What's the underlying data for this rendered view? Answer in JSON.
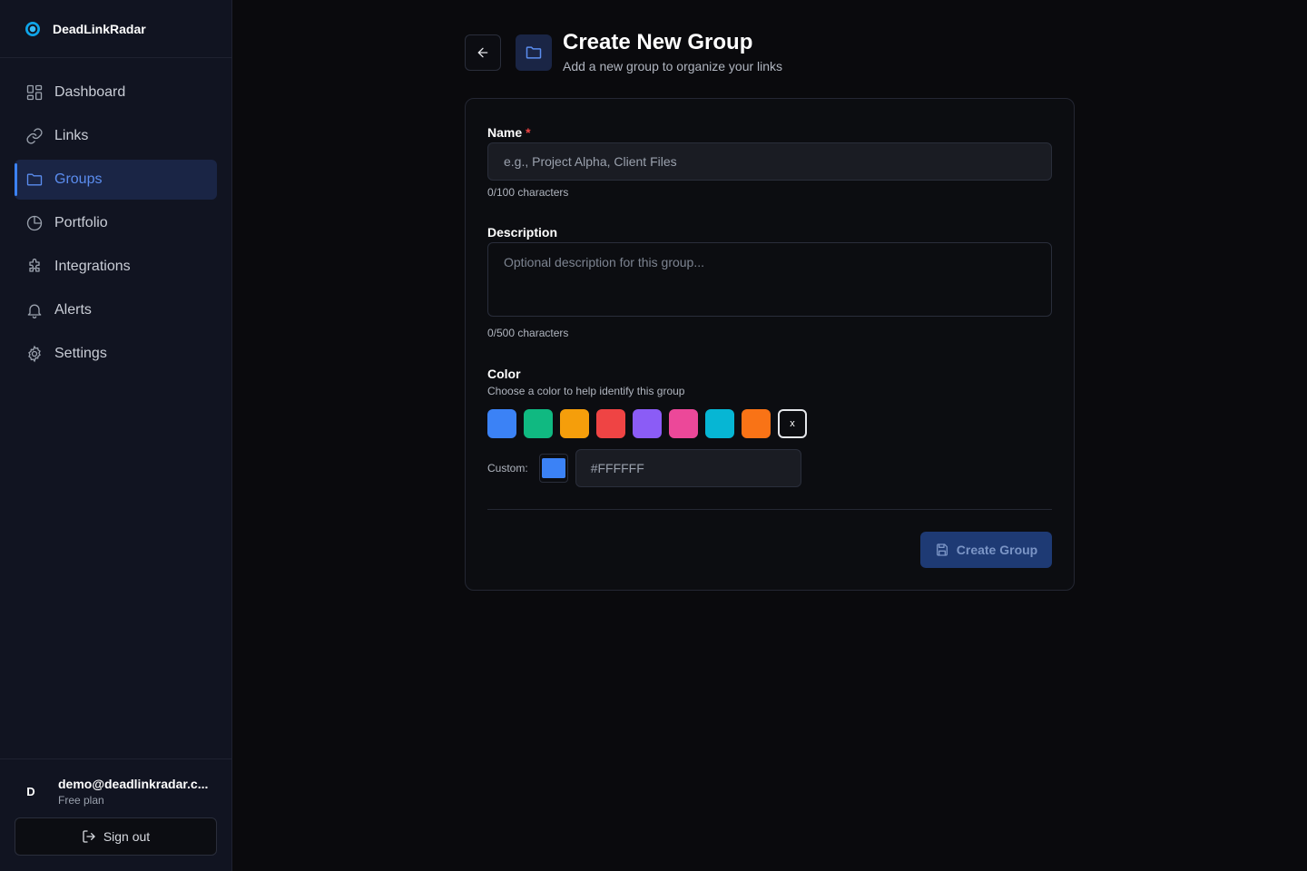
{
  "app": {
    "name": "DeadLinkRadar"
  },
  "sidebar": {
    "items": [
      {
        "label": "Dashboard",
        "icon": "dashboard-icon",
        "active": false
      },
      {
        "label": "Links",
        "icon": "link-icon",
        "active": false
      },
      {
        "label": "Groups",
        "icon": "folder-icon",
        "active": true
      },
      {
        "label": "Portfolio",
        "icon": "pie-chart-icon",
        "active": false
      },
      {
        "label": "Integrations",
        "icon": "puzzle-icon",
        "active": false
      },
      {
        "label": "Alerts",
        "icon": "bell-icon",
        "active": false
      },
      {
        "label": "Settings",
        "icon": "gear-icon",
        "active": false
      }
    ],
    "user": {
      "initial": "D",
      "email": "demo@deadlinkradar.c...",
      "plan": "Free plan"
    },
    "signout_label": "Sign out"
  },
  "header": {
    "title": "Create New Group",
    "subtitle": "Add a new group to organize your links"
  },
  "form": {
    "name": {
      "label": "Name",
      "required_mark": "*",
      "placeholder": "e.g., Project Alpha, Client Files",
      "counter": "0/100 characters"
    },
    "description": {
      "label": "Description",
      "placeholder": "Optional description for this group...",
      "counter": "0/500 characters"
    },
    "color": {
      "label": "Color",
      "hint": "Choose a color to help identify this group",
      "swatches": [
        "#3b82f6",
        "#10b981",
        "#f59e0b",
        "#ef4444",
        "#8b5cf6",
        "#ec4899",
        "#06b6d4",
        "#f97316"
      ],
      "clear_label": "x",
      "custom_label": "Custom:",
      "custom_preview": "#3b82f6",
      "custom_value": "#FFFFFF"
    },
    "submit_label": "Create Group"
  },
  "colors": {
    "accent": "#3b82f6",
    "background": "#0a0a0d",
    "sidebar": "#111421"
  }
}
